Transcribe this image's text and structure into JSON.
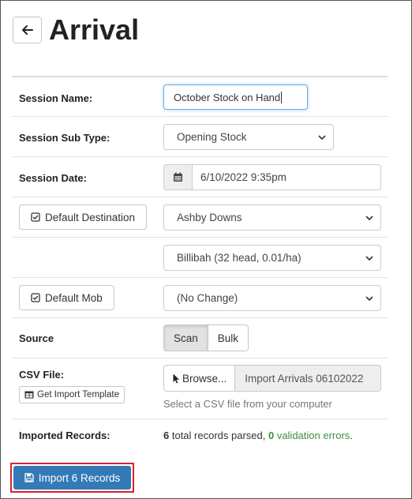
{
  "header": {
    "title": "Arrival",
    "back_icon": "arrow-left-icon"
  },
  "form": {
    "session_name": {
      "label": "Session Name:",
      "value": "October Stock on Hand"
    },
    "session_sub_type": {
      "label": "Session Sub Type:",
      "value": "Opening Stock"
    },
    "session_date": {
      "label": "Session Date:",
      "value": "6/10/2022 9:35pm",
      "icon": "calendar-icon"
    },
    "default_destination": {
      "button_label": "Default Destination",
      "property": "Ashby Downs",
      "paddock": "Billibah (32 head, 0.01/ha)"
    },
    "default_mob": {
      "button_label": "Default Mob",
      "value": "(No Change)"
    },
    "source": {
      "label": "Source",
      "options": [
        "Scan",
        "Bulk"
      ],
      "selected": "Scan"
    },
    "csv_file": {
      "label": "CSV File:",
      "template_button": "Get Import Template",
      "browse_label": "Browse...",
      "file_name": "Import Arrivals 06102022",
      "help_text": "Select a CSV file from your computer"
    },
    "imported_records": {
      "label": "Imported Records:",
      "total": "6",
      "total_text": " total records parsed, ",
      "errors": "0",
      "errors_text": " validation errors",
      "suffix": "."
    }
  },
  "actions": {
    "import_label": "Import 6 Records"
  },
  "colors": {
    "primary": "#337ab7",
    "highlight": "#d9232d",
    "success": "#3c8d3c"
  }
}
